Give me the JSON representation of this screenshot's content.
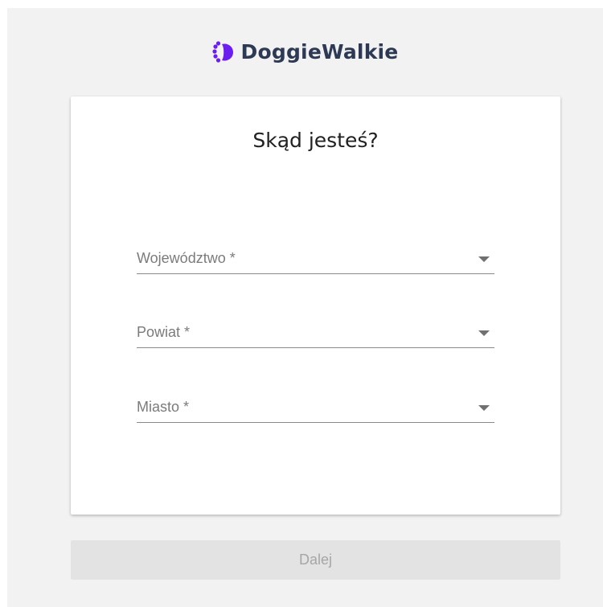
{
  "brand": {
    "name": "DoggieWalkie",
    "logo_icon": "paw-icon",
    "logo_color": "#6c1ef0",
    "name_color": "#2e3a55"
  },
  "form": {
    "title": "Skąd jesteś?",
    "fields": [
      {
        "label": "Województwo *",
        "icon": "chevron-down-icon"
      },
      {
        "label": "Powiat *",
        "icon": "chevron-down-icon"
      },
      {
        "label": "Miasto *",
        "icon": "chevron-down-icon"
      }
    ],
    "next_label": "Dalej",
    "next_disabled": true
  }
}
